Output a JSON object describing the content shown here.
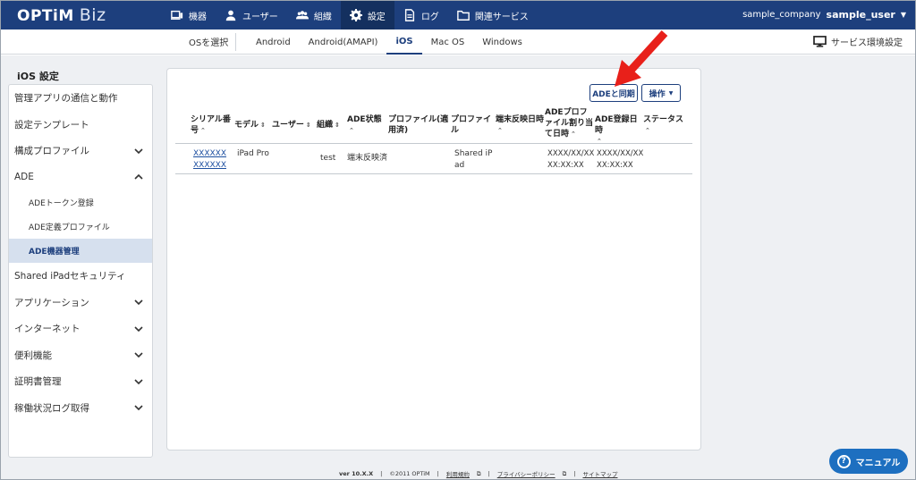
{
  "header": {
    "logo": "OPTiM",
    "logo_suffix": "Biz",
    "nav": [
      {
        "label": "機器",
        "icon": "device-icon"
      },
      {
        "label": "ユーザー",
        "icon": "user-icon"
      },
      {
        "label": "組織",
        "icon": "organization-icon"
      },
      {
        "label": "設定",
        "icon": "gear-icon"
      },
      {
        "label": "ログ",
        "icon": "log-icon"
      },
      {
        "label": "関連サービス",
        "icon": "folder-icon"
      }
    ],
    "active_nav": "設定",
    "company": "sample_company",
    "user": "sample_user"
  },
  "subnav": {
    "select_label": "OSを選択",
    "tabs": [
      "Android",
      "Android(AMAPI)",
      "iOS",
      "Mac OS",
      "Windows"
    ],
    "active_tab": "iOS",
    "env_label": "サービス環境設定"
  },
  "sidebar": {
    "title": "iOS 設定",
    "items": [
      {
        "label": "管理アプリの通信と動作"
      },
      {
        "label": "設定テンプレート"
      },
      {
        "label": "構成プロファイル",
        "chevron": "down"
      },
      {
        "label": "ADE",
        "chevron": "up"
      },
      {
        "label": "ADEトークン登録",
        "sub": true
      },
      {
        "label": "ADE定義プロファイル",
        "sub": true
      },
      {
        "label": "ADE機器管理",
        "sub": true,
        "selected": true
      },
      {
        "label": "Shared iPadセキュリティ"
      },
      {
        "label": "アプリケーション",
        "chevron": "down"
      },
      {
        "label": "インターネット",
        "chevron": "down"
      },
      {
        "label": "便利機能",
        "chevron": "down"
      },
      {
        "label": "証明書管理",
        "chevron": "down"
      },
      {
        "label": "稼働状況ログ取得",
        "chevron": "down"
      }
    ]
  },
  "toolbar": {
    "sync_label": "ADEと同期",
    "ops_label": "操作"
  },
  "table": {
    "headers": {
      "serial": "シリアル番号",
      "model": "モデル",
      "user": "ユーザー",
      "org": "組織",
      "ade_state": "ADE状態",
      "profile_applied": "プロファイル(適用済)",
      "profile": "プロファイル",
      "last_reflect": "端末反映日時",
      "profile_assign": "ADEプロファイル割り当て日時",
      "ade_registered": "ADE登録日時",
      "status": "ステータス"
    },
    "rows": [
      {
        "serial_1": "XXXXXX",
        "serial_2": "XXXXXX",
        "model": "iPad Pro",
        "user": "",
        "org": "test",
        "ade_state": "端末反映済",
        "profile_applied": "",
        "profile": "Shared iPad",
        "last_reflect": "",
        "profile_assign": "XXXX/XX/XX XX:XX:XX",
        "ade_registered": "XXXX/XX/XX XX:XX:XX",
        "status": ""
      }
    ]
  },
  "footer": {
    "version": "ver 10.X.X",
    "copyright": "©2011 OPTiM",
    "terms": "利用規約",
    "privacy": "プライバシーポリシー",
    "sitemap": "サイトマップ"
  },
  "manual_button": "マニュアル",
  "colors": {
    "brand": "#1d3f7d",
    "accent": "#1d6fc0",
    "annotation": "#e8201a"
  }
}
